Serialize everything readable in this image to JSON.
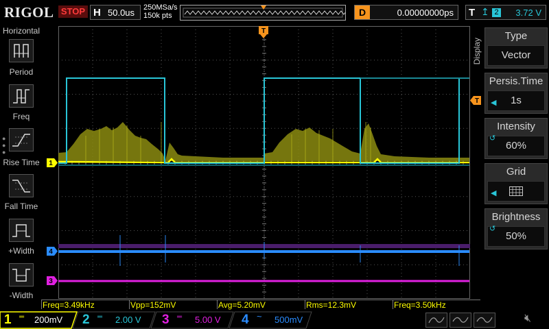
{
  "brand": "RIGOL",
  "run_status": "STOP",
  "horizontal": {
    "label": "H",
    "timebase": "50.0us"
  },
  "acquisition": {
    "sample_rate": "250MSa/s",
    "memory_depth": "150k pts"
  },
  "delay": {
    "label": "D",
    "value": "0.00000000ps"
  },
  "trigger": {
    "label": "T",
    "source": "2",
    "level": "3.72 V",
    "edge_icon": "rising-edge-icon"
  },
  "left_panel": {
    "title": "Horizontal",
    "items": [
      {
        "label": "Period",
        "icon": "period-icon"
      },
      {
        "label": "Freq",
        "icon": "freq-icon"
      },
      {
        "label": "Rise Time",
        "icon": "rise-time-icon"
      },
      {
        "label": "Fall Time",
        "icon": "fall-time-icon"
      },
      {
        "label": "+Width",
        "icon": "pos-width-icon"
      },
      {
        "label": "-Width",
        "icon": "neg-width-icon"
      }
    ]
  },
  "right_panel": {
    "tab": "Display",
    "items": [
      {
        "title": "Type",
        "value": "Vector"
      },
      {
        "title": "Persis.Time",
        "value": "1s"
      },
      {
        "title": "Intensity",
        "value": "60%"
      },
      {
        "title": "Grid",
        "value": ""
      },
      {
        "title": "Brightness",
        "value": "50%"
      }
    ]
  },
  "channel_markers": {
    "ch1": "1",
    "ch2": "2",
    "ch3": "3",
    "ch4": "4",
    "trigger_level": "T"
  },
  "measurements": [
    "Freq=3.49kHz",
    "Vpp=152mV",
    "Avg=5.20mV",
    "Rms=12.3mV",
    "Freq=3.50kHz"
  ],
  "channels": [
    {
      "num": "1",
      "coupling": "DC",
      "scale": "200mV",
      "color": "#ffff00"
    },
    {
      "num": "2",
      "coupling": "DC",
      "scale": "2.00 V",
      "color": "#29c6d8"
    },
    {
      "num": "3",
      "coupling": "DC",
      "scale": "5.00 V",
      "color": "#e020e0"
    },
    {
      "num": "4",
      "coupling": "AC",
      "scale": "500mV",
      "color": "#2a8cff"
    }
  ],
  "colors": {
    "ch1": "#ffff00",
    "ch2": "#29c6d8",
    "ch3": "#e020e0",
    "ch4": "#2a8cff",
    "trigger": "#f7941d",
    "stop": "#ff3b3b",
    "grid": "#555555"
  }
}
